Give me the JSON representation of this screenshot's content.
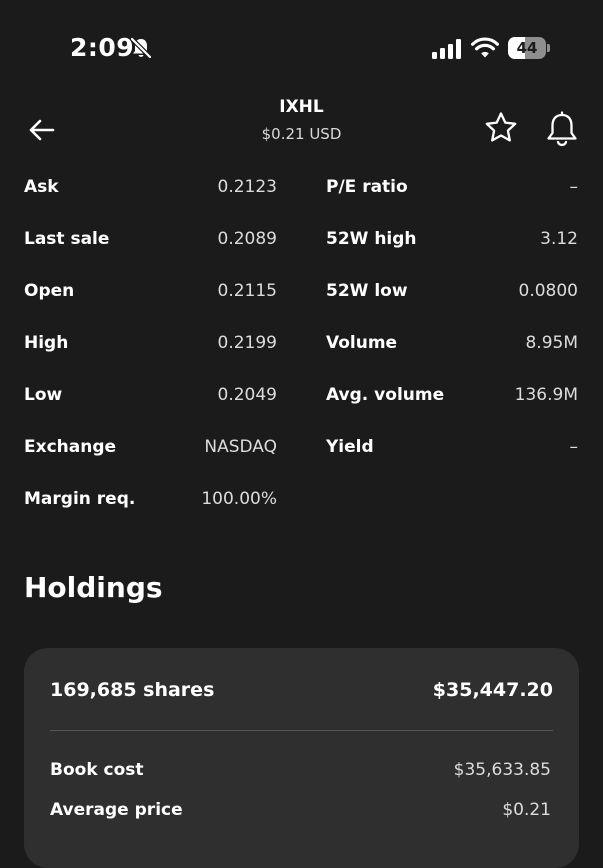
{
  "status_bar": {
    "time": "2:09",
    "battery_level": "44",
    "battery_fraction": 0.44
  },
  "header": {
    "ticker": "IXHL",
    "price": "$0.21 USD"
  },
  "stats": {
    "left": [
      {
        "label": "Ask",
        "value": "0.2123"
      },
      {
        "label": "Last sale",
        "value": "0.2089"
      },
      {
        "label": "Open",
        "value": "0.2115"
      },
      {
        "label": "High",
        "value": "0.2199"
      },
      {
        "label": "Low",
        "value": "0.2049"
      },
      {
        "label": "Exchange",
        "value": "NASDAQ"
      },
      {
        "label": "Margin req.",
        "value": "100.00%"
      }
    ],
    "right": [
      {
        "label": "P/E ratio",
        "value": "–"
      },
      {
        "label": "52W high",
        "value": "3.12"
      },
      {
        "label": "52W low",
        "value": "0.0800"
      },
      {
        "label": "Volume",
        "value": "8.95M"
      },
      {
        "label": "Avg. volume",
        "value": "136.9M"
      },
      {
        "label": "Yield",
        "value": "–"
      }
    ]
  },
  "holdings": {
    "title": "Holdings",
    "shares": "169,685 shares",
    "market_value": "$35,447.20",
    "rows": [
      {
        "label": "Book cost",
        "value": "$35,633.85"
      },
      {
        "label": "Average price",
        "value": "$0.21"
      }
    ]
  },
  "icons": {
    "status": [
      "bell-slash-icon",
      "cellular-signal-icon",
      "wifi-icon",
      "battery-icon"
    ],
    "header": [
      "back-arrow-icon",
      "star-icon",
      "bell-icon"
    ]
  }
}
